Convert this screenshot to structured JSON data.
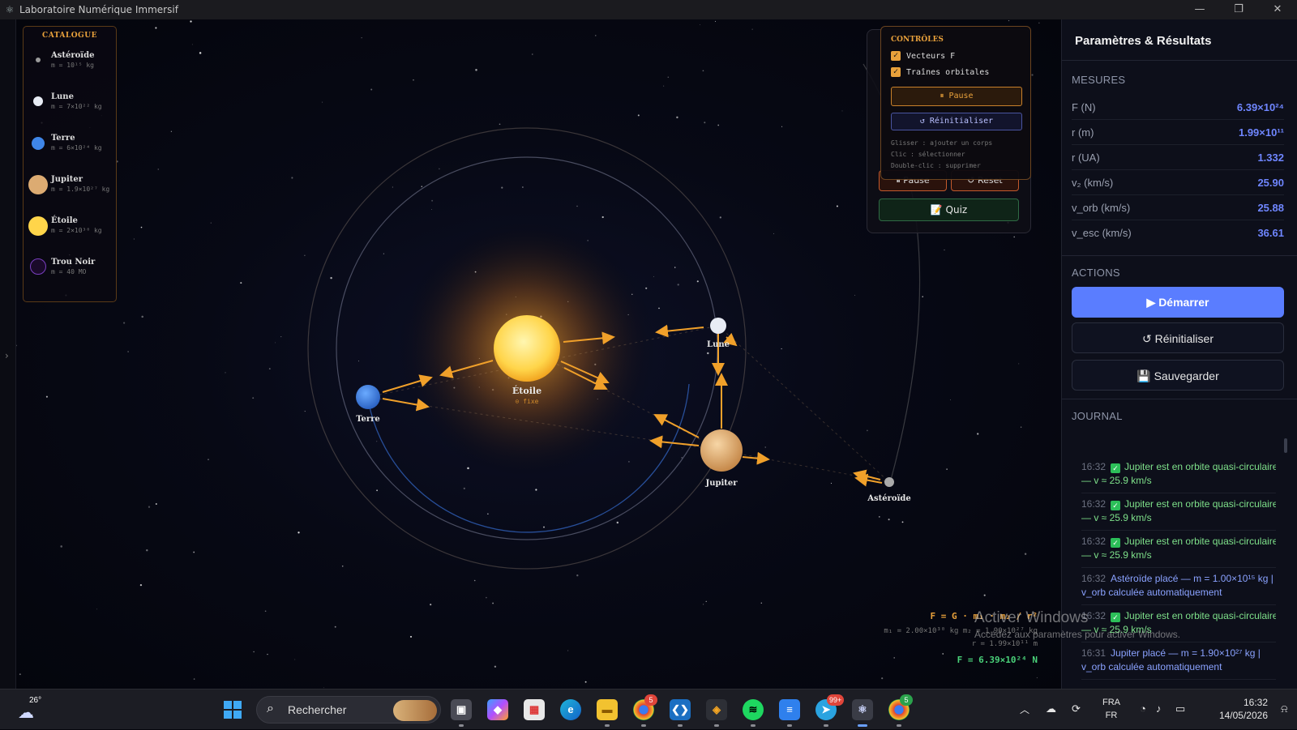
{
  "window": {
    "title": "Laboratoire Numérique Immersif",
    "minimize": "—",
    "maximize": "❐",
    "close": "✕"
  },
  "left_edge": {
    "expander": "›"
  },
  "catalogue": {
    "title": "CATALOGUE",
    "items": [
      {
        "name": "Astéroïde",
        "mass": "m = 10¹⁵ kg",
        "color": "#9a9a9a"
      },
      {
        "name": "Lune",
        "mass": "m = 7×10²² kg",
        "color": "#e8ecf5"
      },
      {
        "name": "Terre",
        "mass": "m = 6×10²⁴ kg",
        "color": "#3f86e8"
      },
      {
        "name": "Jupiter",
        "mass": "m = 1.9×10²⁷ kg",
        "color": "#dcab72"
      },
      {
        "name": "Étoile",
        "mass": "m = 2×10³⁰ kg",
        "color": "#ffd54a"
      },
      {
        "name": "Trou Noir",
        "mass": "m = 40 MO",
        "color": "#1a0a2a"
      }
    ]
  },
  "scene": {
    "bodies": {
      "star": {
        "label": "Étoile",
        "sub": "⊙ fixe"
      },
      "earth": {
        "label": "Terre"
      },
      "moon": {
        "label": "Lune"
      },
      "jupiter": {
        "label": "Jupiter"
      },
      "asteroid": {
        "label": "Astéroïde"
      }
    },
    "colors": {
      "star": "#ffd54a",
      "earth": "#3f86e8",
      "moon": "#e8ecf5",
      "jupiter": "#dcab72",
      "asteroid": "#aaaaaa",
      "vector": "#f0a02a"
    }
  },
  "back_panel": {
    "pause": "⏸ Pause",
    "reset": "↺ Reset",
    "quiz": "📝 Quiz"
  },
  "controls": {
    "title": "CONTRÔLES",
    "checkboxes": [
      {
        "label": "Vecteurs F",
        "checked": true
      },
      {
        "label": "Traînes orbitales",
        "checked": true
      }
    ],
    "pause": "⏸ Pause",
    "reset": "↺ Réinitialiser",
    "hints": [
      "Glisser : ajouter un corps",
      "Clic : sélectionner",
      "Double-clic : supprimer"
    ]
  },
  "formula": {
    "equation": "F = G · m₁ · m₂ / r²",
    "masses": "m₁ = 2.00×10³⁰ kg   m₂ = 1.90×10²⁷ kg",
    "distance": "r = 1.99×10¹¹ m",
    "result": "F = 6.39×10²⁴ N"
  },
  "watermark": {
    "line1": "Activer Windows",
    "line2": "Accédez aux paramètres pour activer Windows."
  },
  "sidebar": {
    "title": "Paramètres & Résultats",
    "measures_title": "MESURES",
    "measures": [
      {
        "label": "F (N)",
        "value": "6.39×10²⁴"
      },
      {
        "label": "r (m)",
        "value": "1.99×10¹¹"
      },
      {
        "label": "r (UA)",
        "value": "1.332"
      },
      {
        "label": "v₂ (km/s)",
        "value": "25.90"
      },
      {
        "label": "v_orb (km/s)",
        "value": "25.88"
      },
      {
        "label": "v_esc (km/s)",
        "value": "36.61"
      }
    ],
    "actions_title": "ACTIONS",
    "start": "▶ Démarrer",
    "reinit": "↺ Réinitialiser",
    "save": "💾 Sauvegarder",
    "journal_title": "JOURNAL",
    "journal": [
      {
        "time": "16:32",
        "text": "Jupiter est en orbite quasi-circulaire — v ≈ 25.9 km/s",
        "kind": "green"
      },
      {
        "time": "16:32",
        "text": "Jupiter est en orbite quasi-circulaire — v ≈ 25.9 km/s",
        "kind": "green"
      },
      {
        "time": "16:32",
        "text": "Jupiter est en orbite quasi-circulaire — v ≈ 25.9 km/s",
        "kind": "green"
      },
      {
        "time": "16:32",
        "text": "Astéroïde placé — m = 1.00×10¹⁵ kg | v_orb calculée automatiquement",
        "kind": "blue"
      },
      {
        "time": "16:32",
        "text": "Jupiter est en orbite quasi-circulaire — v ≈ 25.9 km/s",
        "kind": "green"
      },
      {
        "time": "16:31",
        "text": "Jupiter placé — m = 1.90×10²⁷ kg | v_orb calculée automatiquement",
        "kind": "blue"
      }
    ]
  },
  "taskbar": {
    "weather": "26°",
    "search": "Rechercher",
    "lang1": "FRA",
    "lang2": "FR",
    "time": "16:32",
    "date": "14/05/2026",
    "badges": {
      "chrome": "5",
      "telegram": "99+",
      "chrome2": "5"
    }
  }
}
